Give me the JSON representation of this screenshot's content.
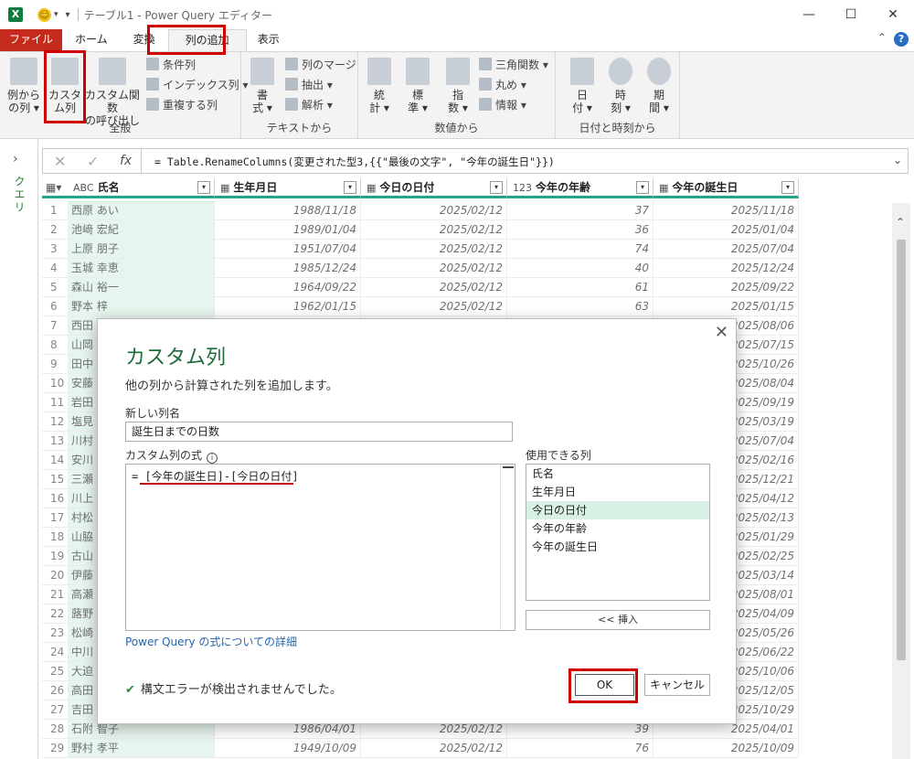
{
  "window": {
    "title": "テーブル1 - Power Query エディター",
    "minimize": "—",
    "maximize": "☐",
    "close": "✕"
  },
  "ribbon_tabs": [
    "ファイル",
    "ホーム",
    "変換",
    "列の追加",
    "表示"
  ],
  "ribbon": {
    "groups": {
      "general": "全般",
      "text": "テキストから",
      "number": "数値から",
      "datetime": "日付と時刻から"
    },
    "example_col": [
      "例から",
      "の列 ▾"
    ],
    "custom_col": [
      "カスタ",
      "ム列"
    ],
    "custom_fn": [
      "カスタム関数",
      "の呼び出し"
    ],
    "conditional": "条件列",
    "index": "インデックス列 ▾",
    "duplicate": "重複する列",
    "format": [
      "書",
      "式 ▾"
    ],
    "merge_cols": "列のマージ",
    "extract": "抽出 ▾",
    "parse": "解析 ▾",
    "stats": [
      "統",
      "計 ▾"
    ],
    "standard": [
      "標",
      "準 ▾"
    ],
    "scientific": [
      "指",
      "数 ▾"
    ],
    "trig": "三角関数 ▾",
    "rounding": "丸め ▾",
    "info": "情報 ▾",
    "date": [
      "日",
      "付 ▾"
    ],
    "time": [
      "時",
      "刻 ▾"
    ],
    "duration": [
      "期",
      "間 ▾"
    ]
  },
  "sidebar": {
    "label": "クエリ"
  },
  "formula_bar": {
    "cancel": "✕",
    "commit": "✓",
    "fx": "fx",
    "text": "= Table.RenameColumns(変更された型3,{{\"最後の文字\", \"今年の誕生日\"}})"
  },
  "grid": {
    "headers": [
      {
        "type": "ABC",
        "label": "氏名"
      },
      {
        "type": "▦",
        "label": "生年月日"
      },
      {
        "type": "▦",
        "label": "今日の日付"
      },
      {
        "type": "123",
        "label": "今年の年齢"
      },
      {
        "type": "▦",
        "label": "今年の誕生日"
      }
    ],
    "rows": [
      [
        "1",
        "西原 あい",
        "1988/11/18",
        "2025/02/12",
        "37",
        "2025/11/18"
      ],
      [
        "2",
        "池﨑 宏紀",
        "1989/01/04",
        "2025/02/12",
        "36",
        "2025/01/04"
      ],
      [
        "3",
        "上原 朋子",
        "1951/07/04",
        "2025/02/12",
        "74",
        "2025/07/04"
      ],
      [
        "4",
        "玉城 幸恵",
        "1985/12/24",
        "2025/02/12",
        "40",
        "2025/12/24"
      ],
      [
        "5",
        "森山 裕一",
        "1964/09/22",
        "2025/02/12",
        "61",
        "2025/09/22"
      ],
      [
        "6",
        "野本 梓",
        "1962/01/15",
        "2025/02/12",
        "63",
        "2025/01/15"
      ],
      [
        "7",
        "西田",
        "",
        "",
        "",
        "2025/08/06"
      ],
      [
        "8",
        "山岡",
        "",
        "",
        "",
        "2025/07/15"
      ],
      [
        "9",
        "田中",
        "",
        "",
        "",
        "2025/10/26"
      ],
      [
        "10",
        "安藤",
        "",
        "",
        "",
        "2025/08/04"
      ],
      [
        "11",
        "岩田",
        "",
        "",
        "",
        "2025/09/19"
      ],
      [
        "12",
        "塩見",
        "",
        "",
        "",
        "2025/03/19"
      ],
      [
        "13",
        "川村",
        "",
        "",
        "",
        "2025/07/04"
      ],
      [
        "14",
        "安川",
        "",
        "",
        "",
        "2025/02/16"
      ],
      [
        "15",
        "三瀬",
        "",
        "",
        "",
        "2025/12/21"
      ],
      [
        "16",
        "川上",
        "",
        "",
        "",
        "2025/04/12"
      ],
      [
        "17",
        "村松",
        "",
        "",
        "",
        "2025/02/13"
      ],
      [
        "18",
        "山脇",
        "",
        "",
        "",
        "2025/01/29"
      ],
      [
        "19",
        "古山",
        "",
        "",
        "",
        "2025/02/25"
      ],
      [
        "20",
        "伊藤",
        "",
        "",
        "",
        "2025/03/14"
      ],
      [
        "21",
        "高瀬",
        "",
        "",
        "",
        "2025/08/01"
      ],
      [
        "22",
        "蕗野",
        "",
        "",
        "",
        "2025/04/09"
      ],
      [
        "23",
        "松崎",
        "",
        "",
        "",
        "2025/05/26"
      ],
      [
        "24",
        "中川",
        "",
        "",
        "",
        "2025/06/22"
      ],
      [
        "25",
        "大迫",
        "",
        "",
        "",
        "2025/10/06"
      ],
      [
        "26",
        "高田",
        "",
        "",
        "",
        "2025/12/05"
      ],
      [
        "27",
        "吉田",
        "",
        "",
        "",
        "2025/10/29"
      ],
      [
        "28",
        "石附 智子",
        "1986/04/01",
        "2025/02/12",
        "39",
        "2025/04/01"
      ],
      [
        "29",
        "野村 孝平",
        "1949/10/09",
        "2025/02/12",
        "76",
        "2025/10/09"
      ]
    ]
  },
  "dialog": {
    "title": "カスタム列",
    "description": "他の列から計算された列を追加します。",
    "new_col_label": "新しい列名",
    "new_col_value": "誕生日までの日数",
    "formula_label": "カスタム列の式",
    "formula": "= [今年の誕生日]-[今日の日付]",
    "available_label": "使用できる列",
    "available_cols": [
      "氏名",
      "生年月日",
      "今日の日付",
      "今年の年齢",
      "今年の誕生日"
    ],
    "selected_col_index": 2,
    "insert_label": "<< 挿入",
    "link": "Power Query の式についての詳細",
    "status": "構文エラーが検出されませんでした。",
    "ok": "OK",
    "cancel": "キャンセル"
  },
  "colors": {
    "accent_green": "#1f6b3c",
    "file_tab": "#c42b1c",
    "highlight_red": "#d00000",
    "teal_header": "#23a58b",
    "selected_row": "#d9f0e4"
  }
}
